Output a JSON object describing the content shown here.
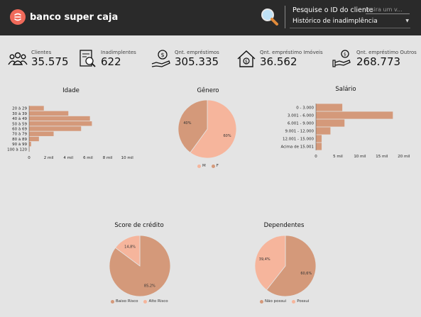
{
  "header": {
    "brand": "banco super caja",
    "filter_label": "Pesquise o ID do cliente",
    "filter_placeholder": "Insira um v...",
    "select_value": "Histórico de inadimplência"
  },
  "kpis": [
    {
      "label": "Clientes",
      "value": "35.575",
      "icon": "people-icon"
    },
    {
      "label": "Inadimplentes",
      "value": "622",
      "icon": "document-search-icon"
    },
    {
      "label": "Qnt. empréstimos",
      "value": "305.335",
      "icon": "money-hand-icon"
    },
    {
      "label": "Qnt. empréstimo Imóveis",
      "value": "36.562",
      "icon": "house-money-icon"
    },
    {
      "label": "Qnt. empréstimo Outros",
      "value": "268.773",
      "icon": "coin-hand-icon"
    }
  ],
  "colors": {
    "bar": "#d4997a",
    "pie_dark": "#d4997a",
    "pie_light": "#f6b59c",
    "header": "#2a2a2a"
  },
  "chart_data": [
    {
      "id": "idade",
      "type": "bar",
      "orientation": "horizontal",
      "title": "Idade",
      "categories": [
        "20 à 29",
        "30 à 39",
        "40 à 49",
        "50 à 59",
        "60 à 69",
        "70 à 79",
        "80 à 89",
        "90 à 99",
        "100 à 120"
      ],
      "values": [
        1500,
        4000,
        6200,
        6400,
        5300,
        2500,
        1000,
        200,
        30
      ],
      "xlim": [
        0,
        11000
      ],
      "xticks": [
        0,
        2000,
        4000,
        6000,
        8000,
        10000
      ],
      "xtick_labels": [
        "0",
        "2 mil",
        "4 mil",
        "6 mil",
        "8 mil",
        "10 mil"
      ]
    },
    {
      "id": "genero",
      "type": "pie",
      "title": "Gênero",
      "slices": [
        {
          "name": "M",
          "value": 60,
          "label": "60%"
        },
        {
          "name": "F",
          "value": 40,
          "label": "40%"
        }
      ]
    },
    {
      "id": "salario",
      "type": "bar",
      "orientation": "horizontal",
      "title": "Salário",
      "categories": [
        "0 - 3.000",
        "3.001 - 6.000",
        "6.001 - 9.000",
        "9.001 - 12.000",
        "12.001 - 15.000",
        "Acima de 15.001"
      ],
      "values": [
        6000,
        17500,
        6500,
        3300,
        1300,
        1300
      ],
      "xlim": [
        0,
        21000
      ],
      "xticks": [
        0,
        5000,
        10000,
        15000,
        20000
      ],
      "xtick_labels": [
        "0",
        "5 mil",
        "10 mil",
        "15 mil",
        "20 mil"
      ]
    },
    {
      "id": "score",
      "type": "pie",
      "title": "Score de crédito",
      "slices": [
        {
          "name": "Baixo Risco",
          "value": 85.2,
          "label": "85,2%"
        },
        {
          "name": "Alto Risco",
          "value": 14.8,
          "label": "14,8%"
        }
      ]
    },
    {
      "id": "dependentes",
      "type": "pie",
      "title": "Dependentes",
      "slices": [
        {
          "name": "Não possui",
          "value": 60.6,
          "label": "60,6%"
        },
        {
          "name": "Possui",
          "value": 39.4,
          "label": "39,4%"
        }
      ]
    }
  ]
}
